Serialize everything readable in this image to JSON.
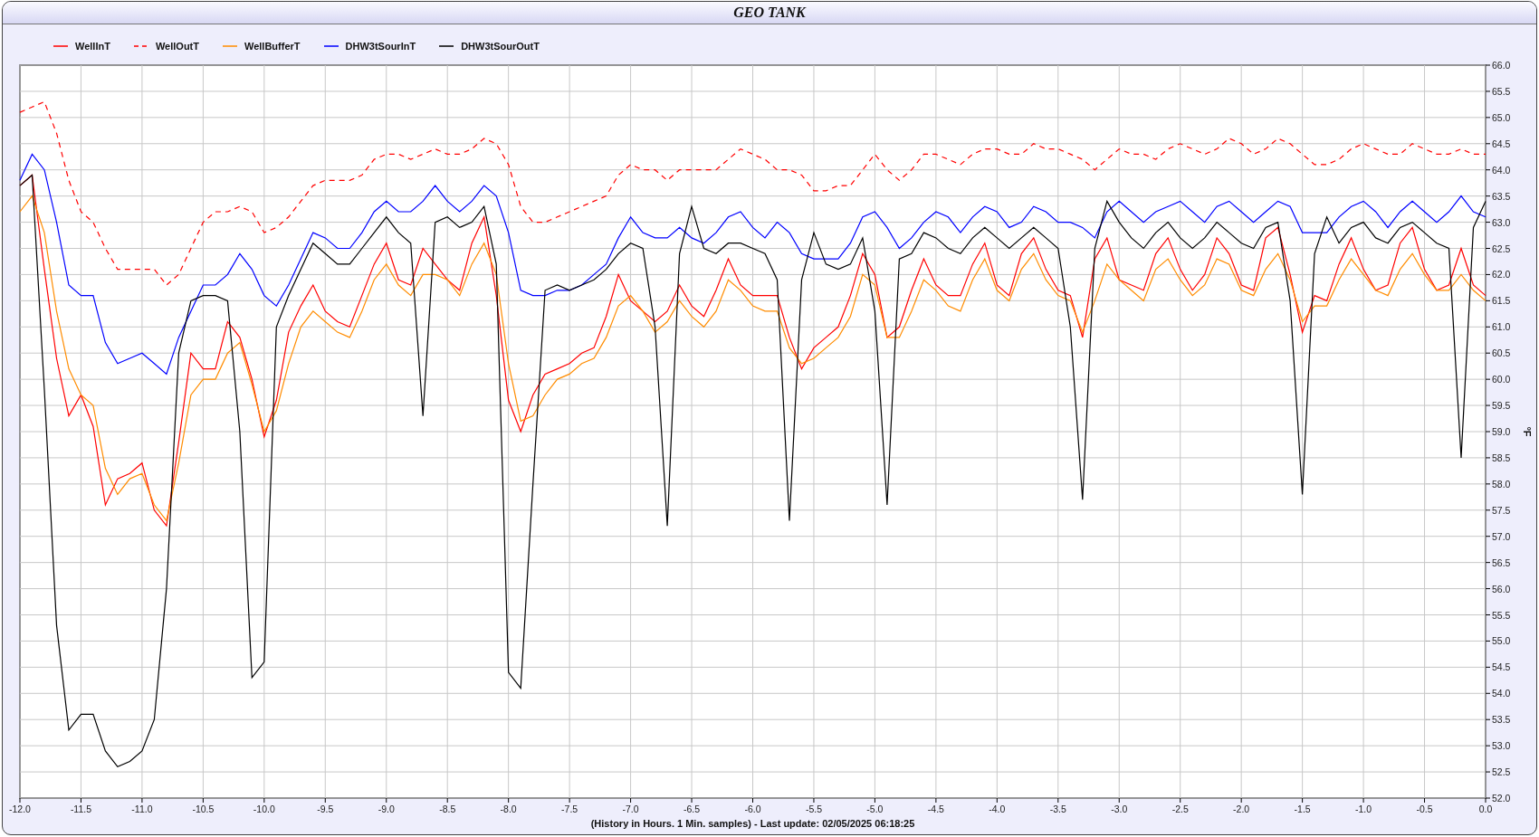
{
  "window": {
    "title": "GEO TANK"
  },
  "chart": {
    "chart_data": {
      "type": "line",
      "grid": true,
      "xlabel": "(History in Hours. 1 Min. samples) - Last update: 02/05/2025 06:18:25",
      "ylabel": "°F",
      "xlim": [
        -12,
        0
      ],
      "ylim": [
        52,
        66
      ],
      "x": [
        -12,
        -11.9,
        -11.8,
        -11.7,
        -11.6,
        -11.5,
        -11.4,
        -11.3,
        -11.2,
        -11.1,
        -11,
        -10.9,
        -10.8,
        -10.7,
        -10.6,
        -10.5,
        -10.4,
        -10.3,
        -10.2,
        -10.1,
        -10,
        -9.9,
        -9.8,
        -9.7,
        -9.6,
        -9.5,
        -9.4,
        -9.3,
        -9.2,
        -9.1,
        -9,
        -8.9,
        -8.8,
        -8.7,
        -8.6,
        -8.5,
        -8.4,
        -8.3,
        -8.2,
        -8.1,
        -8,
        -7.9,
        -7.8,
        -7.7,
        -7.6,
        -7.5,
        -7.4,
        -7.3,
        -7.2,
        -7.1,
        -7,
        -6.9,
        -6.8,
        -6.7,
        -6.6,
        -6.5,
        -6.4,
        -6.3,
        -6.2,
        -6.1,
        -6,
        -5.9,
        -5.8,
        -5.7,
        -5.6,
        -5.5,
        -5.4,
        -5.3,
        -5.2,
        -5.1,
        -5,
        -4.9,
        -4.8,
        -4.7,
        -4.6,
        -4.5,
        -4.4,
        -4.3,
        -4.2,
        -4.1,
        -4,
        -3.9,
        -3.8,
        -3.7,
        -3.6,
        -3.5,
        -3.4,
        -3.3,
        -3.2,
        -3.1,
        -3,
        -2.9,
        -2.8,
        -2.7,
        -2.6,
        -2.5,
        -2.4,
        -2.3,
        -2.2,
        -2.1,
        -2,
        -1.9,
        -1.8,
        -1.7,
        -1.6,
        -1.5,
        -1.4,
        -1.3,
        -1.2,
        -1.1,
        -1,
        -0.9,
        -0.8,
        -0.7,
        -0.6,
        -0.5,
        -0.4,
        -0.3,
        -0.2,
        -0.1,
        0
      ],
      "series": [
        {
          "name": "WellInT",
          "color": "#ff0000",
          "line_style": "solid",
          "values": [
            63.7,
            63.9,
            62.1,
            60.4,
            59.3,
            59.7,
            59.1,
            57.6,
            58.1,
            58.2,
            58.4,
            57.5,
            57.2,
            58.8,
            60.5,
            60.2,
            60.2,
            61.1,
            60.8,
            60,
            58.9,
            59.6,
            60.9,
            61.4,
            61.8,
            61.3,
            61.1,
            61,
            61.6,
            62.2,
            62.6,
            61.9,
            61.8,
            62.5,
            62.2,
            61.9,
            61.7,
            62.6,
            63.1,
            61.6,
            59.6,
            59,
            59.7,
            60.1,
            60.2,
            60.3,
            60.5,
            60.6,
            61.2,
            62,
            61.5,
            61.3,
            61.1,
            61.3,
            61.8,
            61.4,
            61.2,
            61.7,
            62.3,
            61.8,
            61.6,
            61.6,
            61.6,
            60.8,
            60.2,
            60.6,
            60.8,
            61,
            61.6,
            62.4,
            62,
            60.8,
            61,
            61.7,
            62.3,
            61.8,
            61.6,
            61.6,
            62.2,
            62.6,
            61.8,
            61.6,
            62.4,
            62.7,
            62.1,
            61.7,
            61.6,
            60.8,
            62.3,
            62.7,
            61.9,
            61.8,
            61.7,
            62.4,
            62.7,
            62.1,
            61.7,
            62,
            62.7,
            62.4,
            61.8,
            61.7,
            62.7,
            62.9,
            62,
            60.9,
            61.6,
            61.5,
            62.2,
            62.7,
            62.1,
            61.7,
            61.8,
            62.6,
            62.9,
            62.1,
            61.7,
            61.8,
            62.5,
            61.8,
            61.6
          ]
        },
        {
          "name": "WellOutT",
          "color": "#ff0000",
          "line_style": "dashed",
          "values": [
            65.1,
            65.2,
            65.3,
            64.7,
            63.8,
            63.2,
            63,
            62.5,
            62.1,
            62.1,
            62.1,
            62.1,
            61.8,
            62,
            62.5,
            63,
            63.2,
            63.2,
            63.3,
            63.2,
            62.8,
            62.9,
            63.1,
            63.4,
            63.7,
            63.8,
            63.8,
            63.8,
            63.9,
            64.2,
            64.3,
            64.3,
            64.2,
            64.3,
            64.4,
            64.3,
            64.3,
            64.4,
            64.6,
            64.5,
            64.1,
            63.3,
            63,
            63,
            63.1,
            63.2,
            63.3,
            63.4,
            63.5,
            63.9,
            64.1,
            64,
            64,
            63.8,
            64,
            64,
            64,
            64,
            64.2,
            64.4,
            64.3,
            64.2,
            64,
            64,
            63.9,
            63.6,
            63.6,
            63.7,
            63.7,
            64,
            64.3,
            64,
            63.8,
            64,
            64.3,
            64.3,
            64.2,
            64.1,
            64.3,
            64.4,
            64.4,
            64.3,
            64.3,
            64.5,
            64.4,
            64.4,
            64.3,
            64.2,
            64,
            64.2,
            64.4,
            64.3,
            64.3,
            64.2,
            64.4,
            64.5,
            64.4,
            64.3,
            64.4,
            64.6,
            64.5,
            64.3,
            64.4,
            64.6,
            64.5,
            64.3,
            64.1,
            64.1,
            64.2,
            64.4,
            64.5,
            64.4,
            64.3,
            64.3,
            64.5,
            64.4,
            64.3,
            64.3,
            64.4,
            64.3,
            64.3
          ]
        },
        {
          "name": "WellBufferT",
          "color": "#ff8c00",
          "line_style": "solid",
          "values": [
            63.2,
            63.5,
            62.8,
            61.3,
            60.2,
            59.7,
            59.5,
            58.3,
            57.8,
            58.1,
            58.2,
            57.6,
            57.3,
            58.4,
            59.7,
            60,
            60,
            60.5,
            60.7,
            59.9,
            59,
            59.4,
            60.3,
            61,
            61.3,
            61.1,
            60.9,
            60.8,
            61.3,
            61.9,
            62.2,
            61.8,
            61.6,
            62,
            62,
            61.9,
            61.6,
            62.2,
            62.6,
            62,
            60.3,
            59.2,
            59.3,
            59.7,
            60,
            60.1,
            60.3,
            60.4,
            60.8,
            61.4,
            61.6,
            61.3,
            60.9,
            61.1,
            61.5,
            61.2,
            61,
            61.3,
            61.9,
            61.7,
            61.4,
            61.3,
            61.3,
            60.6,
            60.3,
            60.4,
            60.6,
            60.8,
            61.2,
            62,
            61.8,
            60.8,
            60.8,
            61.3,
            61.9,
            61.7,
            61.4,
            61.3,
            61.9,
            62.3,
            61.7,
            61.5,
            62.1,
            62.4,
            61.9,
            61.6,
            61.5,
            60.9,
            61.5,
            62.2,
            61.9,
            61.7,
            61.5,
            62.1,
            62.3,
            61.9,
            61.6,
            61.8,
            62.3,
            62.2,
            61.7,
            61.6,
            62.1,
            62.4,
            61.9,
            61.1,
            61.4,
            61.4,
            61.9,
            62.3,
            62,
            61.7,
            61.6,
            62.1,
            62.4,
            62,
            61.7,
            61.7,
            62,
            61.7,
            61.5
          ]
        },
        {
          "name": "DHW3tSourInT",
          "color": "#0000ff",
          "line_style": "solid",
          "values": [
            63.8,
            64.3,
            64,
            63,
            61.8,
            61.6,
            61.6,
            60.7,
            60.3,
            60.4,
            60.5,
            60.3,
            60.1,
            60.8,
            61.3,
            61.8,
            61.8,
            62,
            62.4,
            62.1,
            61.6,
            61.4,
            61.8,
            62.3,
            62.8,
            62.7,
            62.5,
            62.5,
            62.8,
            63.2,
            63.4,
            63.2,
            63.2,
            63.4,
            63.7,
            63.4,
            63.2,
            63.4,
            63.7,
            63.5,
            62.8,
            61.7,
            61.6,
            61.6,
            61.7,
            61.7,
            61.8,
            62,
            62.2,
            62.7,
            63.1,
            62.8,
            62.7,
            62.7,
            62.9,
            62.7,
            62.6,
            62.8,
            63.1,
            63.2,
            62.9,
            62.7,
            63,
            62.8,
            62.4,
            62.3,
            62.3,
            62.3,
            62.6,
            63.1,
            63.2,
            62.9,
            62.5,
            62.7,
            63,
            63.2,
            63.1,
            62.8,
            63.1,
            63.3,
            63.2,
            62.9,
            63,
            63.3,
            63.2,
            63,
            63,
            62.9,
            62.7,
            63.2,
            63.4,
            63.2,
            63,
            63.2,
            63.3,
            63.4,
            63.2,
            63,
            63.3,
            63.4,
            63.2,
            63,
            63.2,
            63.4,
            63.3,
            62.8,
            62.8,
            62.8,
            63.1,
            63.3,
            63.4,
            63.2,
            62.9,
            63.2,
            63.4,
            63.2,
            63,
            63.2,
            63.5,
            63.2,
            63.1
          ]
        },
        {
          "name": "DHW3tSourOutT",
          "color": "#000000",
          "line_style": "solid",
          "values": [
            63.7,
            63.9,
            59.8,
            55.3,
            53.3,
            53.6,
            53.6,
            52.9,
            52.6,
            52.7,
            52.9,
            53.5,
            56,
            60.5,
            61.5,
            61.6,
            61.6,
            61.5,
            59,
            54.3,
            54.6,
            61,
            61.6,
            62.1,
            62.6,
            62.4,
            62.2,
            62.2,
            62.5,
            62.8,
            63.1,
            62.8,
            62.6,
            59.3,
            63,
            63.1,
            62.9,
            63,
            63.3,
            62.2,
            54.4,
            54.1,
            58,
            61.7,
            61.8,
            61.7,
            61.8,
            61.9,
            62.1,
            62.4,
            62.6,
            62.5,
            61,
            57.2,
            62.4,
            63.3,
            62.5,
            62.4,
            62.6,
            62.6,
            62.5,
            62.4,
            61.9,
            57.3,
            61.9,
            62.8,
            62.2,
            62.1,
            62.2,
            62.7,
            61.3,
            57.6,
            62.3,
            62.4,
            62.8,
            62.7,
            62.5,
            62.4,
            62.7,
            62.9,
            62.7,
            62.5,
            62.7,
            62.9,
            62.7,
            62.5,
            61,
            57.7,
            62.5,
            63.4,
            63,
            62.7,
            62.5,
            62.8,
            63,
            62.7,
            62.5,
            62.7,
            63,
            62.8,
            62.6,
            62.5,
            62.9,
            63,
            61.5,
            57.8,
            62.4,
            63.1,
            62.6,
            62.9,
            63,
            62.7,
            62.6,
            62.9,
            63,
            62.8,
            62.6,
            62.5,
            58.5,
            62.9,
            63.4
          ]
        }
      ],
      "xticks": [
        {
          "value": -12,
          "label": "-12.0"
        },
        {
          "value": -11.5,
          "label": "-11.5"
        },
        {
          "value": -11,
          "label": "-11.0"
        },
        {
          "value": -10.5,
          "label": "-10.5"
        },
        {
          "value": -10,
          "label": "-10.0"
        },
        {
          "value": -9.5,
          "label": "-9.5"
        },
        {
          "value": -9,
          "label": "-9.0"
        },
        {
          "value": -8.5,
          "label": "-8.5"
        },
        {
          "value": -8,
          "label": "-8.0"
        },
        {
          "value": -7.5,
          "label": "-7.5"
        },
        {
          "value": -7,
          "label": "-7.0"
        },
        {
          "value": -6.5,
          "label": "-6.5"
        },
        {
          "value": -6,
          "label": "-6.0"
        },
        {
          "value": -5.5,
          "label": "-5.5"
        },
        {
          "value": -5,
          "label": "-5.0"
        },
        {
          "value": -4.5,
          "label": "-4.5"
        },
        {
          "value": -4,
          "label": "-4.0"
        },
        {
          "value": -3.5,
          "label": "-3.5"
        },
        {
          "value": -3,
          "label": "-3.0"
        },
        {
          "value": -2.5,
          "label": "-2.5"
        },
        {
          "value": -2,
          "label": "-2.0"
        },
        {
          "value": -1.5,
          "label": "-1.5"
        },
        {
          "value": -1,
          "label": "-1.0"
        },
        {
          "value": -0.5,
          "label": "-0.5"
        },
        {
          "value": 0,
          "label": "0.0"
        }
      ],
      "yticks": [
        {
          "value": 52,
          "label": "52.0"
        },
        {
          "value": 52.5,
          "label": "52.5"
        },
        {
          "value": 53,
          "label": "53.0"
        },
        {
          "value": 53.5,
          "label": "53.5"
        },
        {
          "value": 54,
          "label": "54.0"
        },
        {
          "value": 54.5,
          "label": "54.5"
        },
        {
          "value": 55,
          "label": "55.0"
        },
        {
          "value": 55.5,
          "label": "55.5"
        },
        {
          "value": 56,
          "label": "56.0"
        },
        {
          "value": 56.5,
          "label": "56.5"
        },
        {
          "value": 57,
          "label": "57.0"
        },
        {
          "value": 57.5,
          "label": "57.5"
        },
        {
          "value": 58,
          "label": "58.0"
        },
        {
          "value": 58.5,
          "label": "58.5"
        },
        {
          "value": 59,
          "label": "59.0"
        },
        {
          "value": 59.5,
          "label": "59.5"
        },
        {
          "value": 60,
          "label": "60.0"
        },
        {
          "value": 60.5,
          "label": "60.5"
        },
        {
          "value": 61,
          "label": "61.0"
        },
        {
          "value": 61.5,
          "label": "61.5"
        },
        {
          "value": 62,
          "label": "62.0"
        },
        {
          "value": 62.5,
          "label": "62.5"
        },
        {
          "value": 63,
          "label": "63.0"
        },
        {
          "value": 63.5,
          "label": "63.5"
        },
        {
          "value": 64,
          "label": "64.0"
        },
        {
          "value": 64.5,
          "label": "64.5"
        },
        {
          "value": 65,
          "label": "65.0"
        },
        {
          "value": 65.5,
          "label": "65.5"
        },
        {
          "value": 66,
          "label": "66.0"
        }
      ]
    }
  }
}
